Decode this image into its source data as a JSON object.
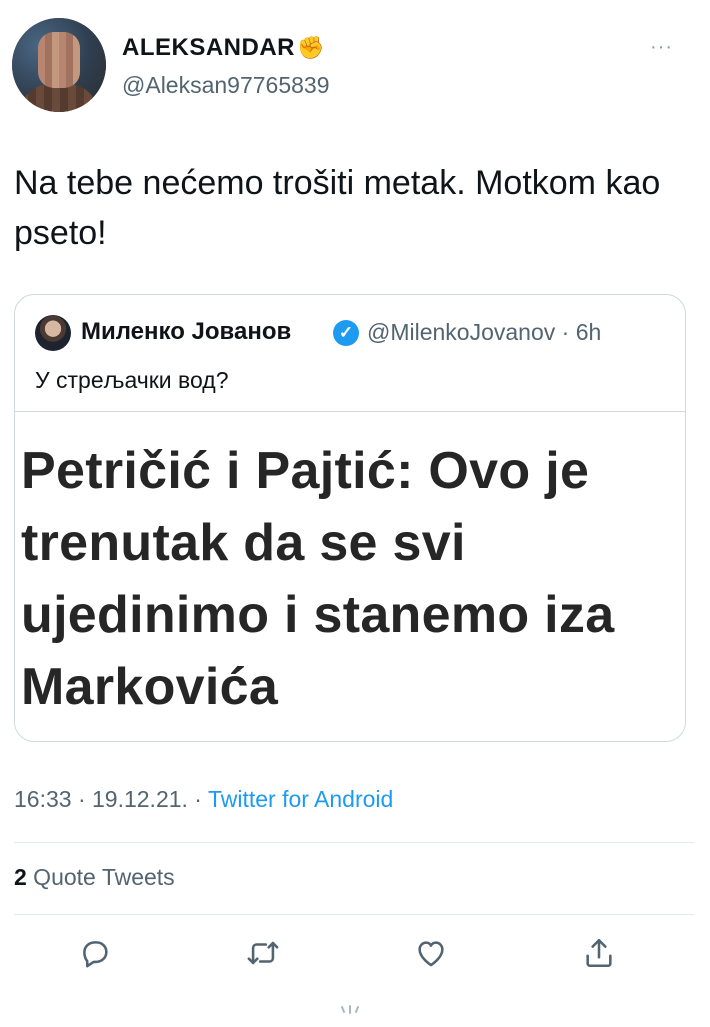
{
  "author": {
    "display_name": "ALEKSANDAR",
    "name_emoji": "✊",
    "handle": "@Aleksan97765839"
  },
  "more_menu": "···",
  "tweet": {
    "text": "Na tebe nećemo trošiti metak. Motkom kao pseto!"
  },
  "quoted_tweet": {
    "display_name": "Миленко Јованов",
    "handle_time": "@MilenkoJovanov · 6h",
    "text": "У стрељачки вод?",
    "headline": "Petričić i Pajtić: Ovo je trenutak da se svi ujedinimo i stanemo iza Markovića"
  },
  "meta": {
    "time_date": "16:33 · 19.12.21. · ",
    "source": "Twitter for Android"
  },
  "stats": {
    "quote_count": "2",
    "quote_label": " Quote Tweets"
  },
  "actions": [
    "reply-icon",
    "retweet-icon",
    "like-icon",
    "share-icon"
  ],
  "colors": {
    "accent": "#1d9bf0",
    "secondary_text": "#536471",
    "primary_text": "#0f1419"
  }
}
